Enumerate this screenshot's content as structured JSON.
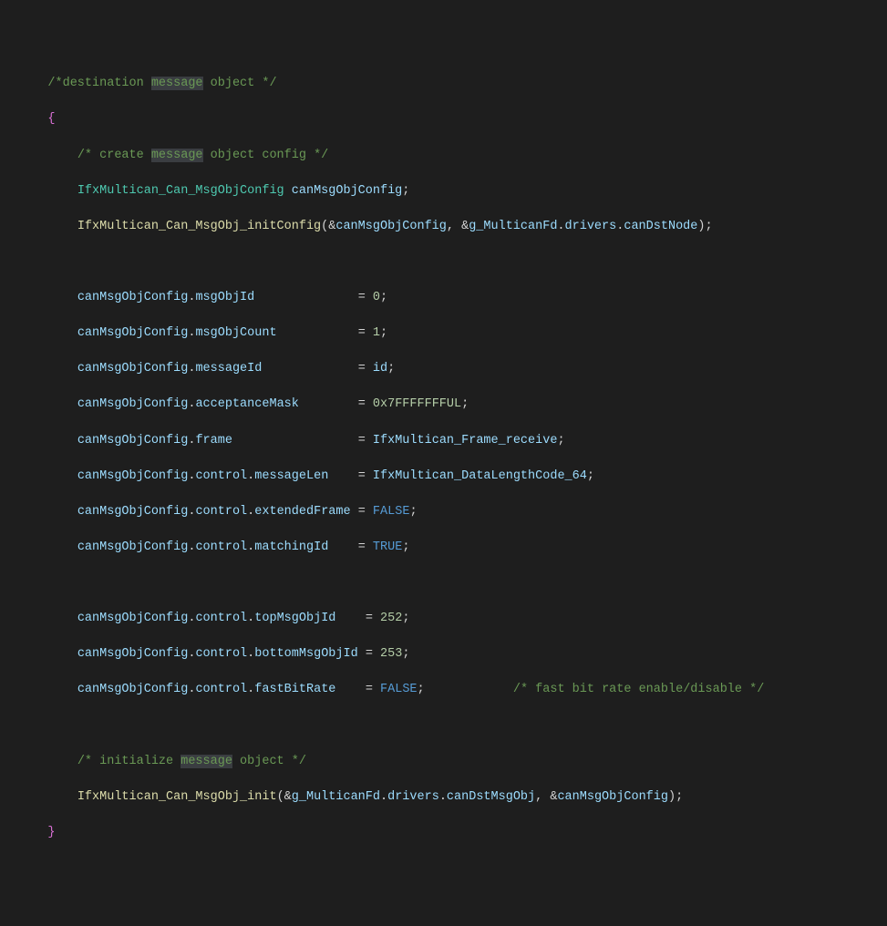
{
  "lines": {
    "l1_comment_pre": "/*destination ",
    "l1_comment_hl": "message",
    "l1_comment_post": " object */",
    "l2_brace": "{",
    "l3_comment_pre": "/* create ",
    "l3_comment_hl": "message",
    "l3_comment_post": " object config */",
    "l4_type": "IfxMultican_Can_MsgObjConfig",
    "l4_var": "canMsgObjConfig",
    "l5_func": "IfxMultican_Can_MsgObj_initConfig",
    "l5_arg1": "canMsgObjConfig",
    "l5_arg2a": "g_MulticanFd",
    "l5_arg2b": "drivers",
    "l5_arg2c": "canDstNode",
    "l6_obj": "canMsgObjConfig",
    "l6_field": "msgObjId",
    "l6_val": "0",
    "l7_field": "msgObjCount",
    "l7_val": "1",
    "l8_field": "messageId",
    "l8_val": "id",
    "l9_field": "acceptanceMask",
    "l9_val": "0x7FFFFFFFUL",
    "l10_field": "frame",
    "l10_val": "IfxMultican_Frame_receive",
    "l11_field1": "control",
    "l11_field2": "messageLen",
    "l11_val": "IfxMultican_DataLengthCode_64",
    "l12_field2": "extendedFrame",
    "l12_val": "FALSE",
    "l13_field2": "matchingId",
    "l13_val": "TRUE",
    "l14_field2": "topMsgObjId",
    "l14_val": "252",
    "l15_field2": "bottomMsgObjId",
    "l15_val": "253",
    "l16_field2": "fastBitRate",
    "l16_val": "FALSE",
    "l16_comment": "/* fast bit rate enable/disable */",
    "l17_comment_pre": "/* initialize ",
    "l17_comment_hl": "message",
    "l17_comment_post": " object */",
    "l18_func": "IfxMultican_Can_MsgObj_init",
    "l18_arg1a": "g_MulticanFd",
    "l18_arg1b": "drivers",
    "l18_arg1c": "canDstMsgObj",
    "l18_arg2": "canMsgObjConfig",
    "l19_brace": "}"
  }
}
